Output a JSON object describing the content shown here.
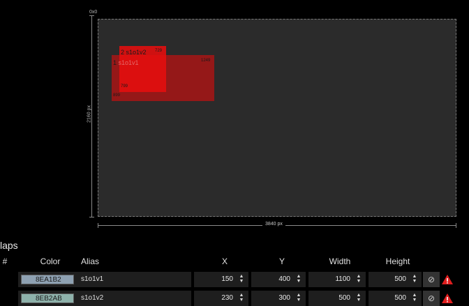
{
  "canvas": {
    "origin_label": "0x0",
    "height_label": "2160 px",
    "width_label": "3840 px",
    "rects": [
      {
        "number": "1",
        "alias": "s1o1v1",
        "right_value": "1249",
        "bottom_value": "899",
        "color": "#BE1010"
      },
      {
        "number": "2",
        "alias": "s1o1v2",
        "right_value": "729",
        "bottom_value": "799",
        "color": "#E60E0E"
      }
    ]
  },
  "maps": {
    "title": "laps",
    "columns": {
      "index": "#",
      "color": "Color",
      "alias": "Alias",
      "x": "X",
      "y": "Y",
      "width": "Width",
      "height": "Height"
    },
    "rows": [
      {
        "color_hex": "8EA1B2",
        "swatch": "#8EA1B2",
        "alias": "s1o1v1",
        "x": "150",
        "y": "400",
        "width": "1100",
        "height": "500"
      },
      {
        "color_hex": "8EB2AB",
        "swatch": "#8EB2AB",
        "alias": "s1o1v2",
        "x": "230",
        "y": "300",
        "width": "500",
        "height": "500"
      }
    ]
  },
  "icons": {
    "reset": "undo-icon",
    "pick": "pick-color-icon",
    "warning": "warning-icon"
  }
}
